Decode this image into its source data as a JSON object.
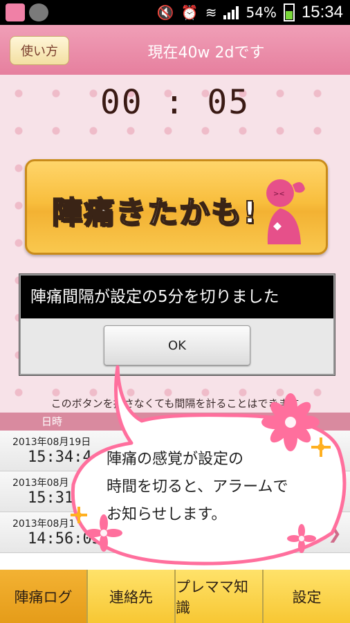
{
  "status_bar": {
    "battery": "54%",
    "time": "15:34"
  },
  "header": {
    "help_label": "使い方",
    "title": "現在40w 2dです"
  },
  "timer": "00 : 05",
  "main_button": {
    "label": "陣痛きたかも!"
  },
  "hint": "このボタンを押さなくても間隔を計ることはできます",
  "log": {
    "header": "日時",
    "rows": [
      {
        "date": "2013年08月19日",
        "time": "15:34:4"
      },
      {
        "date": "2013年08月",
        "time": "15:31:2"
      },
      {
        "date": "2013年08月1",
        "time": "14:56:05"
      }
    ]
  },
  "dialog": {
    "message": "陣痛間隔が設定の5分を切りました",
    "ok_label": "OK"
  },
  "bubble": {
    "line1": "陣痛の感覚が設定の",
    "line2": "時間を切ると、アラームで",
    "line3": "お知らせします。"
  },
  "nav": {
    "items": [
      {
        "label": "陣痛ログ"
      },
      {
        "label": "連絡先"
      },
      {
        "label": "プレママ知識"
      },
      {
        "label": "設定"
      }
    ]
  },
  "colors": {
    "header_pink": "#e67f9e",
    "button_orange": "#f8be3d",
    "accent_pink": "#ff6f9d"
  }
}
